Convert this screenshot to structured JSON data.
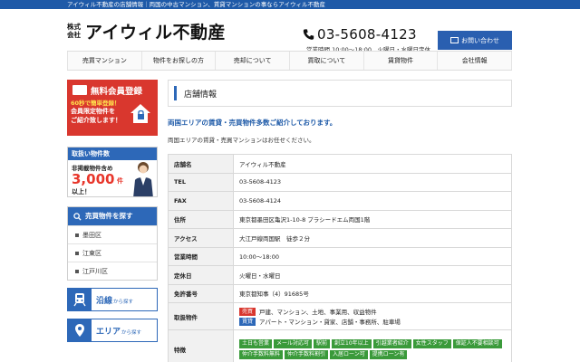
{
  "topbar": {
    "text": "アイウィル不動産の店舗情報｜両国の中古マンション、賃貸マンションの事ならアイウィル不動産"
  },
  "header": {
    "logo_kabu_1": "株式",
    "logo_kabu_2": "会社",
    "logo_name": "アイウィル不動産",
    "phone": "03-5608-4123",
    "hours": "営業時間 10:00〜18:00　火曜日・水曜日定休",
    "contact_label": "お問い合わせ"
  },
  "nav": {
    "items": [
      "売買マンション",
      "物件をお探しの方",
      "売却について",
      "買取について",
      "賃貸物件",
      "会社情報"
    ]
  },
  "sidebar": {
    "banner1": {
      "title": "無料会員登録",
      "sub": "60秒で簡単登録！",
      "line2": "会員限定物件を",
      "line3": "ご紹介致します！",
      "line4": ""
    },
    "banner2": {
      "head": "取扱い物件数",
      "line1": "非掲載物件含め",
      "number": "3,000",
      "unit": "件",
      "line3": "以上！"
    },
    "search": {
      "head": "売買物件を探す",
      "items": [
        "墨田区",
        "江東区",
        "江戸川区"
      ]
    },
    "buttons": [
      {
        "big": "沿線",
        "small": "から探す"
      },
      {
        "big": "エリア",
        "small": "から探す"
      }
    ]
  },
  "main": {
    "section_title": "店舗情報",
    "intro_head": "両国エリアの賃貸・売買物件多数ご紹介しております。",
    "intro_text": "両国エリアの賃貸・売買マンションはお任せください。",
    "rows": [
      {
        "label": "店舗名",
        "value": "アイウィル不動産"
      },
      {
        "label": "TEL",
        "value": "03-5608-4123"
      },
      {
        "label": "FAX",
        "value": "03-5608-4124"
      },
      {
        "label": "住所",
        "value": "東京都墨田区亀沢1-10-8 プラシードエム両国1階"
      },
      {
        "label": "アクセス",
        "value": "大江戸線両国駅　徒歩２分"
      },
      {
        "label": "営業時間",
        "value": "10:00〜18:00"
      },
      {
        "label": "定休日",
        "value": "火曜日・水曜日"
      },
      {
        "label": "免許番号",
        "value": "東京都知事（4）91685号"
      }
    ],
    "handling": {
      "label": "取扱物件",
      "sale_tag": "売買",
      "sale_text": "戸建、マンション、土地、事業用、収益物件",
      "rent_tag": "賃貸",
      "rent_text": "アパート・マンション・貸家、店舗・事務所、駐車場"
    },
    "features": {
      "label": "特徴",
      "tags": [
        "土日も営業",
        "メール対応可",
        "駅前",
        "創立10年以上",
        "引越業者紹介",
        "女性スタッフ",
        "保証人不要相談可",
        "仲介手数料無料",
        "仲介手数料割引",
        "入居ローン可",
        "提携ローン有"
      ]
    }
  },
  "colors": {
    "brand_blue": "#2d68b8",
    "accent_red": "#d9372e",
    "feature_green": "#3a9a3a"
  }
}
